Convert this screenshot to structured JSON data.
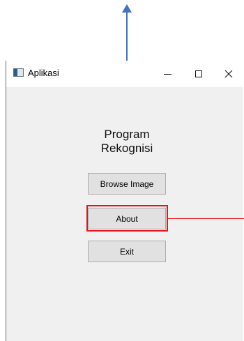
{
  "window": {
    "title": "Aplikasi",
    "controls": {
      "minimize_icon": "minimize-icon",
      "maximize_icon": "maximize-icon",
      "close_icon": "close-icon"
    }
  },
  "content": {
    "heading_line1": "Program",
    "heading_line2": "Rekognisi",
    "buttons": {
      "browse": "Browse Image",
      "about": "About",
      "exit": "Exit"
    }
  },
  "annotations": {
    "arrow_color": "#4472c4",
    "highlight_color": "#e8141b"
  }
}
